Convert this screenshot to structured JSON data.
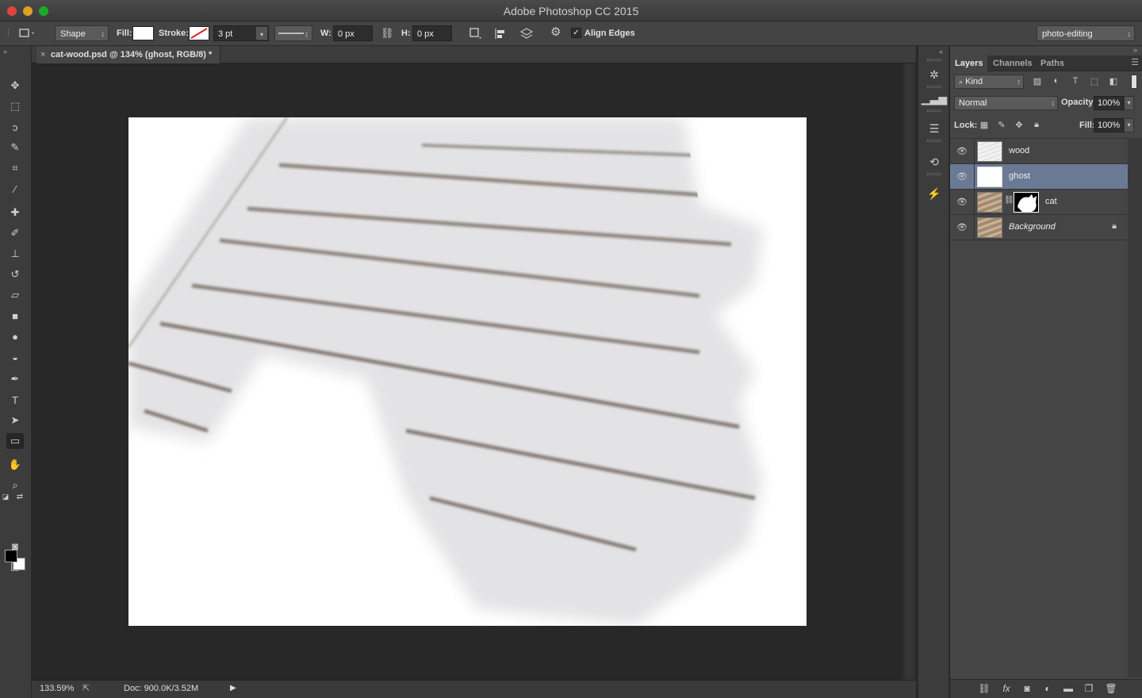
{
  "window": {
    "title": "Adobe Photoshop CC 2015"
  },
  "options_bar": {
    "mode": "Shape",
    "fill_label": "Fill:",
    "stroke_label": "Stroke:",
    "stroke_size": "3 pt",
    "width_label": "W:",
    "width_value": "0 px",
    "height_label": "H:",
    "height_value": "0 px",
    "align_edges_label": "Align Edges",
    "align_edges_checked": true,
    "workspace": "photo-editing"
  },
  "document": {
    "tab_title": "cat-wood.psd @ 134% (ghost, RGB/8) *",
    "close_glyph": "×"
  },
  "status_bar": {
    "zoom": "133.59%",
    "doc_info": "Doc: 900.0K/3.52M"
  },
  "toolbar": {
    "tools": [
      {
        "name": "move-tool",
        "glyph": "✥"
      },
      {
        "name": "marquee-tool",
        "glyph": "⬚"
      },
      {
        "name": "lasso-tool",
        "glyph": "ↄ"
      },
      {
        "name": "quick-selection-tool",
        "glyph": "✎"
      },
      {
        "name": "crop-tool",
        "glyph": "⌗"
      },
      {
        "name": "eyedropper-tool",
        "glyph": "⁄"
      },
      {
        "name": "healing-brush-tool",
        "glyph": "✚"
      },
      {
        "name": "brush-tool",
        "glyph": "✐"
      },
      {
        "name": "clone-stamp-tool",
        "glyph": "⊥"
      },
      {
        "name": "history-brush-tool",
        "glyph": "↺"
      },
      {
        "name": "eraser-tool",
        "glyph": "▱"
      },
      {
        "name": "gradient-tool",
        "glyph": "■"
      },
      {
        "name": "blur-tool",
        "glyph": "●"
      },
      {
        "name": "dodge-tool",
        "glyph": "◒"
      },
      {
        "name": "pen-tool",
        "glyph": "✒"
      },
      {
        "name": "type-tool",
        "glyph": "T"
      },
      {
        "name": "path-selection-tool",
        "glyph": "➤"
      },
      {
        "name": "rectangle-tool",
        "glyph": "▭"
      },
      {
        "name": "hand-tool",
        "glyph": "✋"
      },
      {
        "name": "zoom-tool",
        "glyph": "⌕"
      },
      {
        "name": "quick-mask-tool",
        "glyph": "◙"
      },
      {
        "name": "screen-mode-tool",
        "glyph": "▣"
      }
    ],
    "active_tool": "rectangle-tool",
    "foreground_color": "#000000",
    "background_color": "#ffffff"
  },
  "layers_panel": {
    "tabs": [
      "Layers",
      "Channels",
      "Paths"
    ],
    "active_tab": "Layers",
    "filter_kind": "Kind",
    "blend_mode": "Normal",
    "opacity_label": "Opacity:",
    "opacity_value": "100%",
    "lock_label": "Lock:",
    "fill_label": "Fill:",
    "fill_value": "100%",
    "layers": [
      {
        "name": "wood",
        "visible": true,
        "selected": false,
        "has_mask": false,
        "locked": false,
        "italic": false
      },
      {
        "name": "ghost",
        "visible": true,
        "selected": true,
        "has_mask": false,
        "locked": false,
        "italic": false
      },
      {
        "name": "cat",
        "visible": true,
        "selected": false,
        "has_mask": true,
        "locked": false,
        "italic": false
      },
      {
        "name": "Background",
        "visible": true,
        "selected": false,
        "has_mask": false,
        "locked": true,
        "italic": true
      }
    ]
  },
  "colors": {
    "selected_layer": "#6b7a94",
    "panel_bg": "#454545",
    "canvas_bg": "#282828"
  }
}
